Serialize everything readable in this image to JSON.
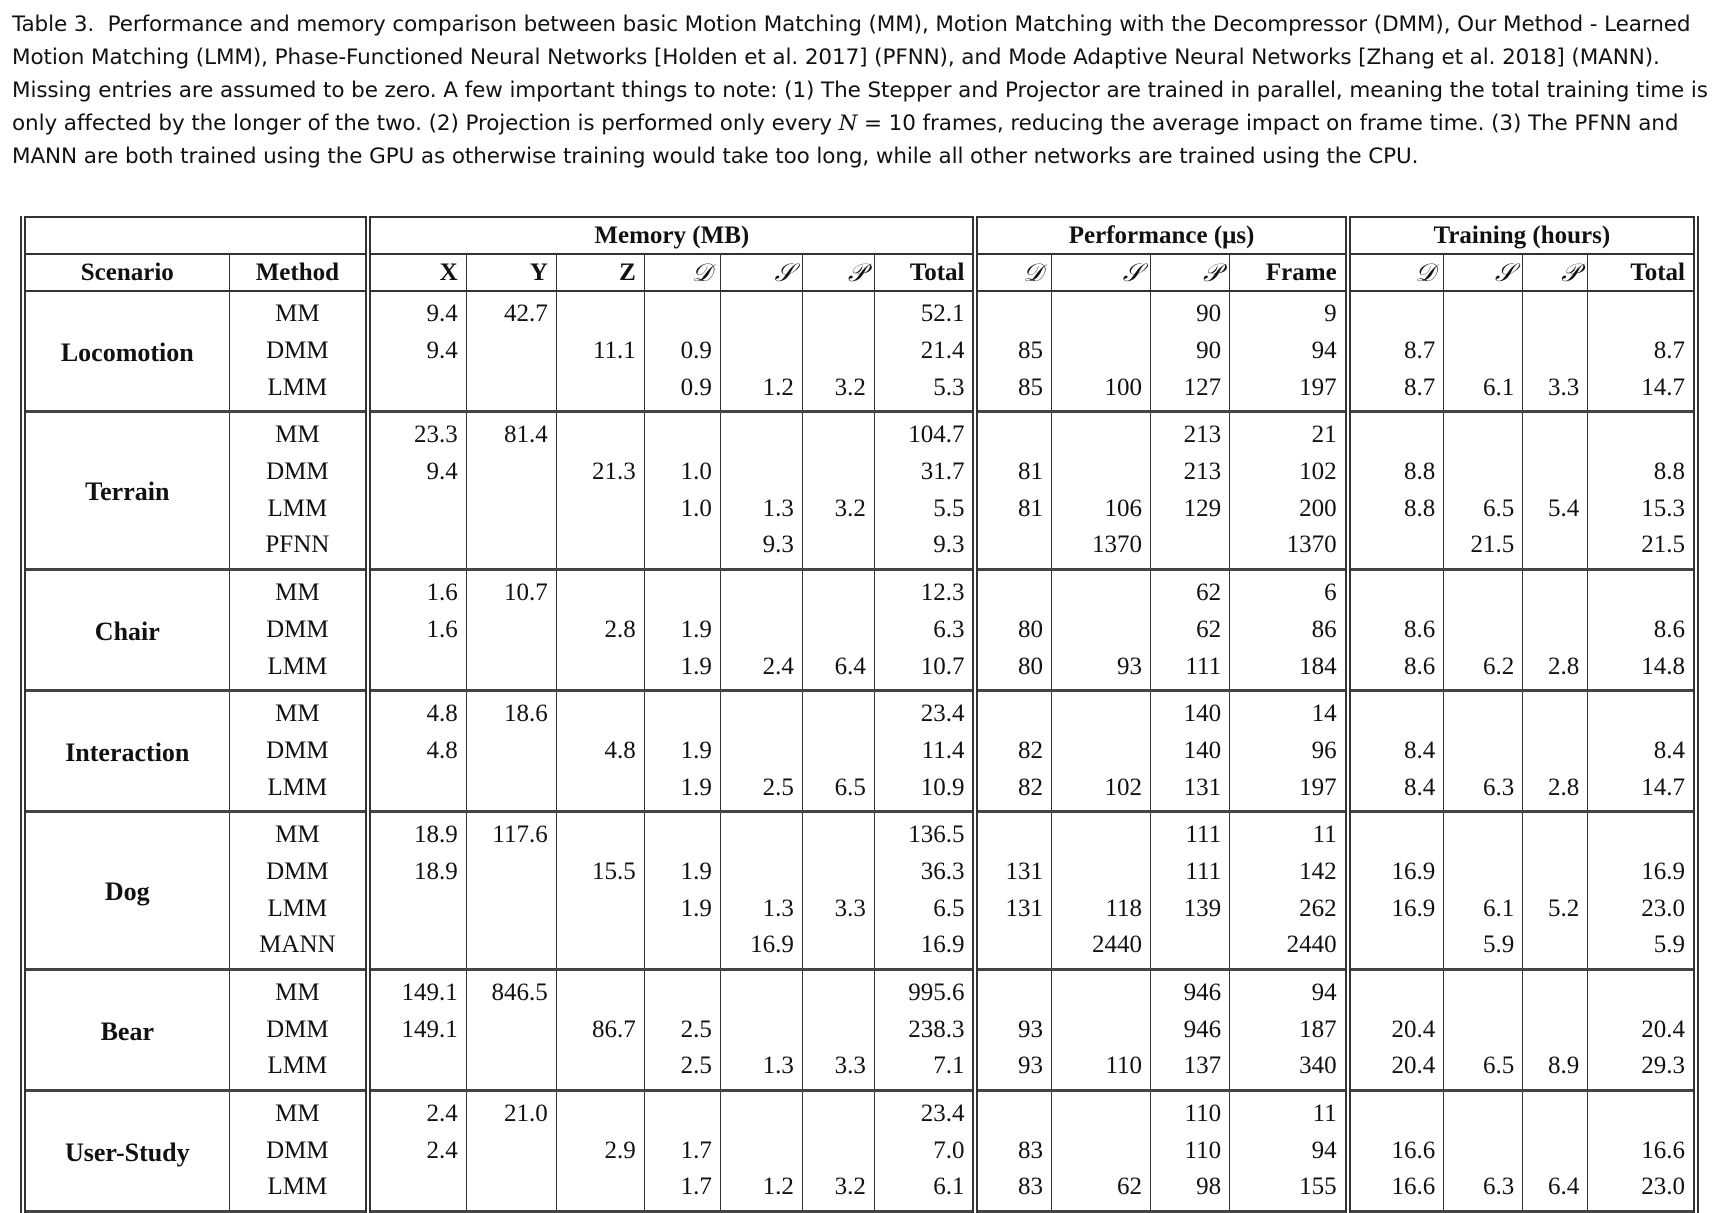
{
  "caption": {
    "label": "Table 3.",
    "text_before_n": "Performance and memory comparison between basic Motion Matching (MM), Motion Matching with the Decompressor (DMM), Our Method - Learned Motion Matching (LMM), Phase-Functioned Neural Networks [Holden et al. 2017] (PFNN), and Mode Adaptive Neural Networks [Zhang et al. 2018] (MANN). Missing entries are assumed to be zero. A few important things to note: (1) The Stepper and Projector are trained in parallel, meaning the total training time is only affected by the longer of the two. (2) Projection is performed only every ",
    "n": "N",
    "text_after_n": " = 10 frames, reducing the average impact on frame time. (3) The PFNN and MANN are both trained using the GPU as otherwise training would take too long, while all other networks are trained using the CPU."
  },
  "groups": [
    "Memory (MB)",
    "Performance (μs)",
    "Training (hours)"
  ],
  "columns": [
    "Scenario",
    "Method",
    "X",
    "Y",
    "Z",
    "𝒟",
    "𝒮",
    "𝒫",
    "Total",
    "𝒟",
    "𝒮",
    "𝒫",
    "Frame",
    "𝒟",
    "𝒮",
    "𝒫",
    "Total"
  ],
  "scenarios": [
    {
      "name": "Locomotion",
      "rows": [
        [
          "MM",
          "9.4",
          "42.7",
          "",
          "",
          "",
          "",
          "52.1",
          "",
          "",
          "90",
          "9",
          "",
          "",
          "",
          ""
        ],
        [
          "DMM",
          "9.4",
          "",
          "11.1",
          "0.9",
          "",
          "",
          "21.4",
          "85",
          "",
          "90",
          "94",
          "8.7",
          "",
          "",
          "8.7"
        ],
        [
          "LMM",
          "",
          "",
          "",
          "0.9",
          "1.2",
          "3.2",
          "5.3",
          "85",
          "100",
          "127",
          "197",
          "8.7",
          "6.1",
          "3.3",
          "14.7"
        ]
      ]
    },
    {
      "name": "Terrain",
      "rows": [
        [
          "MM",
          "23.3",
          "81.4",
          "",
          "",
          "",
          "",
          "104.7",
          "",
          "",
          "213",
          "21",
          "",
          "",
          "",
          ""
        ],
        [
          "DMM",
          "9.4",
          "",
          "21.3",
          "1.0",
          "",
          "",
          "31.7",
          "81",
          "",
          "213",
          "102",
          "8.8",
          "",
          "",
          "8.8"
        ],
        [
          "LMM",
          "",
          "",
          "",
          "1.0",
          "1.3",
          "3.2",
          "5.5",
          "81",
          "106",
          "129",
          "200",
          "8.8",
          "6.5",
          "5.4",
          "15.3"
        ],
        [
          "PFNN",
          "",
          "",
          "",
          "",
          "9.3",
          "",
          "9.3",
          "",
          "1370",
          "",
          "1370",
          "",
          "21.5",
          "",
          "21.5"
        ]
      ]
    },
    {
      "name": "Chair",
      "rows": [
        [
          "MM",
          "1.6",
          "10.7",
          "",
          "",
          "",
          "",
          "12.3",
          "",
          "",
          "62",
          "6",
          "",
          "",
          "",
          ""
        ],
        [
          "DMM",
          "1.6",
          "",
          "2.8",
          "1.9",
          "",
          "",
          "6.3",
          "80",
          "",
          "62",
          "86",
          "8.6",
          "",
          "",
          "8.6"
        ],
        [
          "LMM",
          "",
          "",
          "",
          "1.9",
          "2.4",
          "6.4",
          "10.7",
          "80",
          "93",
          "111",
          "184",
          "8.6",
          "6.2",
          "2.8",
          "14.8"
        ]
      ]
    },
    {
      "name": "Interaction",
      "rows": [
        [
          "MM",
          "4.8",
          "18.6",
          "",
          "",
          "",
          "",
          "23.4",
          "",
          "",
          "140",
          "14",
          "",
          "",
          "",
          ""
        ],
        [
          "DMM",
          "4.8",
          "",
          "4.8",
          "1.9",
          "",
          "",
          "11.4",
          "82",
          "",
          "140",
          "96",
          "8.4",
          "",
          "",
          "8.4"
        ],
        [
          "LMM",
          "",
          "",
          "",
          "1.9",
          "2.5",
          "6.5",
          "10.9",
          "82",
          "102",
          "131",
          "197",
          "8.4",
          "6.3",
          "2.8",
          "14.7"
        ]
      ]
    },
    {
      "name": "Dog",
      "rows": [
        [
          "MM",
          "18.9",
          "117.6",
          "",
          "",
          "",
          "",
          "136.5",
          "",
          "",
          "111",
          "11",
          "",
          "",
          "",
          ""
        ],
        [
          "DMM",
          "18.9",
          "",
          "15.5",
          "1.9",
          "",
          "",
          "36.3",
          "131",
          "",
          "111",
          "142",
          "16.9",
          "",
          "",
          "16.9"
        ],
        [
          "LMM",
          "",
          "",
          "",
          "1.9",
          "1.3",
          "3.3",
          "6.5",
          "131",
          "118",
          "139",
          "262",
          "16.9",
          "6.1",
          "5.2",
          "23.0"
        ],
        [
          "MANN",
          "",
          "",
          "",
          "",
          "16.9",
          "",
          "16.9",
          "",
          "2440",
          "",
          "2440",
          "",
          "5.9",
          "",
          "5.9"
        ]
      ]
    },
    {
      "name": "Bear",
      "rows": [
        [
          "MM",
          "149.1",
          "846.5",
          "",
          "",
          "",
          "",
          "995.6",
          "",
          "",
          "946",
          "94",
          "",
          "",
          "",
          ""
        ],
        [
          "DMM",
          "149.1",
          "",
          "86.7",
          "2.5",
          "",
          "",
          "238.3",
          "93",
          "",
          "946",
          "187",
          "20.4",
          "",
          "",
          "20.4"
        ],
        [
          "LMM",
          "",
          "",
          "",
          "2.5",
          "1.3",
          "3.3",
          "7.1",
          "93",
          "110",
          "137",
          "340",
          "20.4",
          "6.5",
          "8.9",
          "29.3"
        ]
      ]
    },
    {
      "name": "User-Study",
      "rows": [
        [
          "MM",
          "2.4",
          "21.0",
          "",
          "",
          "",
          "",
          "23.4",
          "",
          "",
          "110",
          "11",
          "",
          "",
          "",
          ""
        ],
        [
          "DMM",
          "2.4",
          "",
          "2.9",
          "1.7",
          "",
          "",
          "7.0",
          "83",
          "",
          "110",
          "94",
          "16.6",
          "",
          "",
          "16.6"
        ],
        [
          "LMM",
          "",
          "",
          "",
          "1.7",
          "1.2",
          "3.2",
          "6.1",
          "83",
          "62",
          "98",
          "155",
          "16.6",
          "6.3",
          "6.4",
          "23.0"
        ]
      ]
    }
  ]
}
